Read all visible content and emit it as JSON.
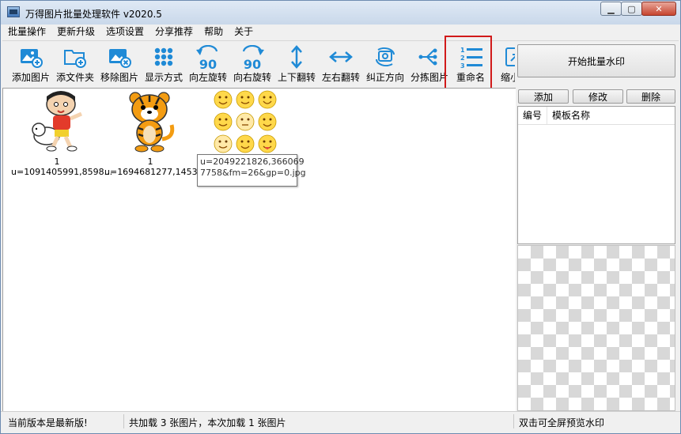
{
  "window": {
    "title": "万得图片批量处理软件 v2020.5",
    "min_icon": "minimize-icon",
    "max_icon": "maximize-icon",
    "close_icon": "close-icon",
    "min_glyph": "▁",
    "max_glyph": "▢",
    "close_glyph": "✕"
  },
  "menu": [
    "批量操作",
    "更新升级",
    "选项设置",
    "分享推荐",
    "帮助",
    "关于"
  ],
  "toolbar": [
    {
      "label": "添加图片",
      "icon": "add-image-icon"
    },
    {
      "label": "添文件夹",
      "icon": "add-folder-icon"
    },
    {
      "label": "移除图片",
      "icon": "remove-image-icon"
    },
    {
      "label": "显示方式",
      "icon": "display-mode-icon"
    },
    {
      "label": "向左旋转",
      "icon": "rotate-left-icon",
      "badge": "90"
    },
    {
      "label": "向右旋转",
      "icon": "rotate-right-icon",
      "badge": "90"
    },
    {
      "label": "上下翻转",
      "icon": "flip-vertical-icon"
    },
    {
      "label": "左右翻转",
      "icon": "flip-horizontal-icon"
    },
    {
      "label": "纠正方向",
      "icon": "correct-orientation-icon"
    },
    {
      "label": "分拣图片",
      "icon": "sort-images-icon"
    },
    {
      "label": "重命名",
      "icon": "rename-icon",
      "highlighted": true
    },
    {
      "label": "缩小图",
      "icon": "shrink-icon"
    }
  ],
  "rename_badge": [
    "1",
    "2",
    "3"
  ],
  "images": [
    {
      "count": "1",
      "filename": "u=1091405991,8598...",
      "picture": "cartoon-boy-with-dog"
    },
    {
      "count": "1",
      "filename": "u=1694681277,1453...",
      "picture": "cartoon-tiger"
    },
    {
      "count": "1",
      "filename": "u=2049221826,366069",
      "picture": "emoji-faces-grid"
    }
  ],
  "tooltip": {
    "line1": "u=2049221826,366069",
    "line2": "7758&fm=26&gp=0.jpg"
  },
  "right_panel": {
    "start_button": "开始批量水印",
    "buttons": [
      "添加",
      "修改",
      "删除"
    ],
    "columns": [
      "编号",
      "模板名称"
    ]
  },
  "status": {
    "version": "当前版本是最新版!",
    "loaded": "共加载 3 张图片，本次加载 1 张图片",
    "hint": "双击可全屏预览水印"
  },
  "colors": {
    "accent": "#1f8ad6",
    "highlight": "#d11a1a"
  }
}
